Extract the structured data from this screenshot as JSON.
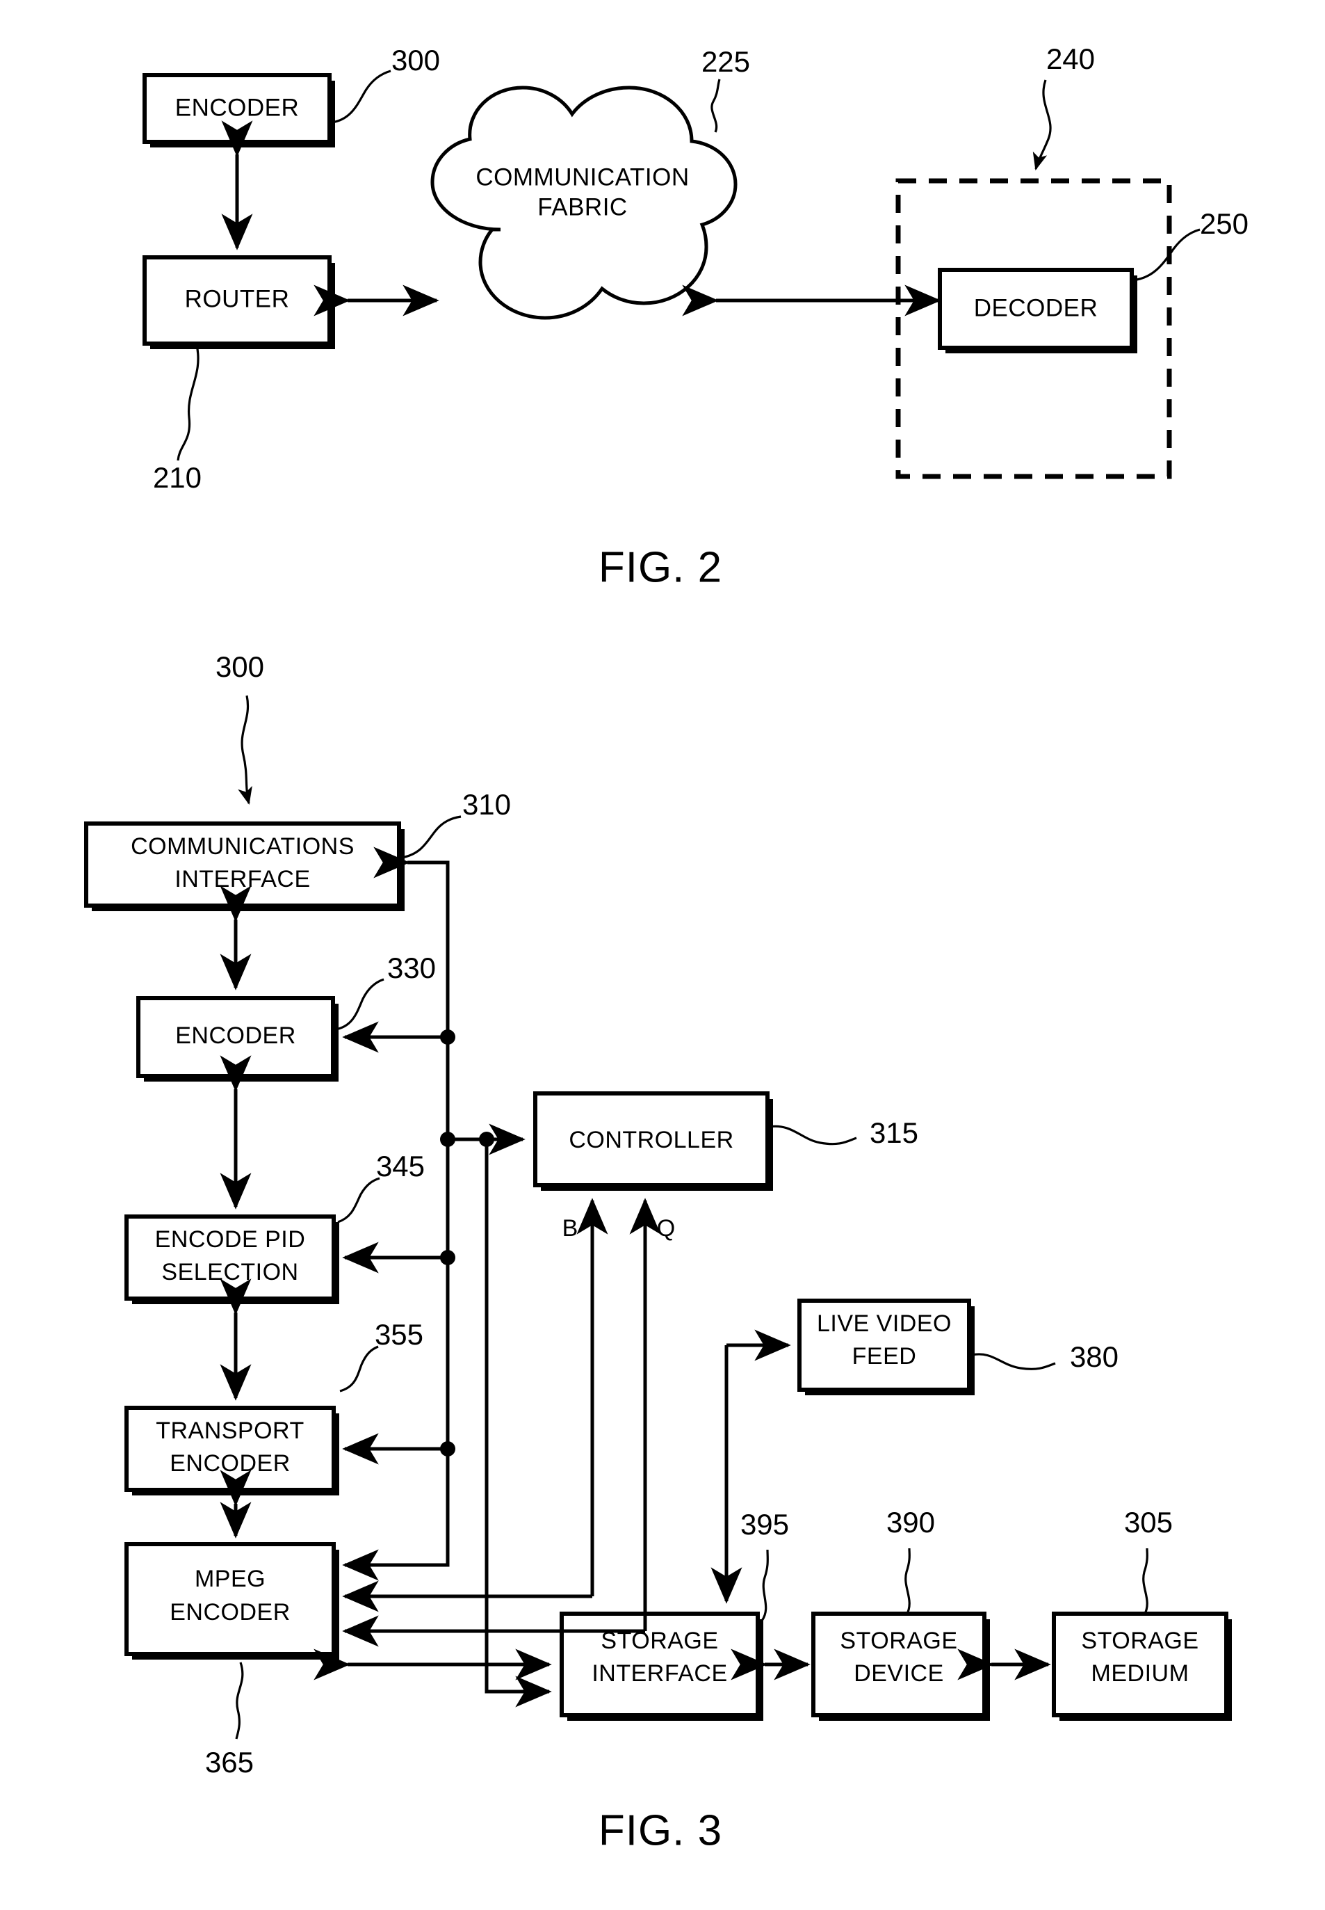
{
  "figures": [
    {
      "id": "fig2",
      "caption": "FIG. 2",
      "blocks": {
        "encoder": "ENCODER",
        "router": "ROUTER",
        "cloud_line1": "COMMUNICATION",
        "cloud_line2": "FABRIC",
        "decoder": "DECODER"
      },
      "refs": {
        "encoder": "300",
        "router": "210",
        "cloud": "225",
        "receiver_group": "240",
        "decoder": "250"
      }
    },
    {
      "id": "fig3",
      "caption": "FIG. 3",
      "blocks": {
        "comm_interface_line1": "COMMUNICATIONS",
        "comm_interface_line2": "INTERFACE",
        "encoder": "ENCODER",
        "encode_pid_line1": "ENCODE PID",
        "encode_pid_line2": "SELECTION",
        "transport_line1": "TRANSPORT",
        "transport_line2": "ENCODER",
        "mpeg_line1": "MPEG",
        "mpeg_line2": "ENCODER",
        "controller": "CONTROLLER",
        "live_video_line1": "LIVE VIDEO",
        "live_video_line2": "FEED",
        "storage_interface_line1": "STORAGE",
        "storage_interface_line2": "INTERFACE",
        "storage_device_line1": "STORAGE",
        "storage_device_line2": "DEVICE",
        "storage_medium_line1": "STORAGE",
        "storage_medium_line2": "MEDIUM"
      },
      "refs": {
        "system": "300",
        "comm_interface": "310",
        "encoder": "330",
        "encode_pid": "345",
        "transport_encoder": "355",
        "mpeg_encoder": "365",
        "controller": "315",
        "live_video_feed": "380",
        "storage_interface": "395",
        "storage_device": "390",
        "storage_medium": "305"
      },
      "signals": {
        "b": "B",
        "q": "Q"
      }
    }
  ],
  "colors": {
    "ink": "#000000",
    "paper": "#ffffff"
  }
}
